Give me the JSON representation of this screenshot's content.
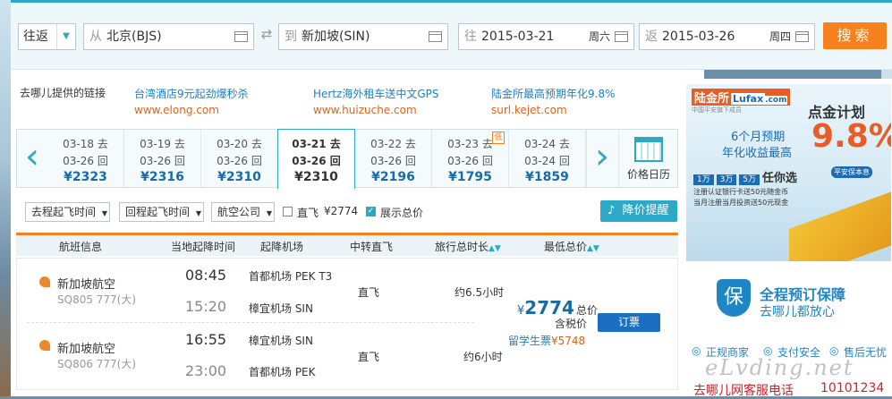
{
  "search": {
    "trip_type": "往返",
    "from_placeholder": "从",
    "from_value": "北京(BJS)",
    "to_placeholder": "到",
    "to_value": "新加坡(SIN)",
    "depart_placeholder": "往",
    "depart_date": "2015-03-21",
    "depart_weekday": "周六",
    "return_placeholder": "返",
    "return_date": "2015-03-26",
    "return_weekday": "周四",
    "search_button": "搜索"
  },
  "links": {
    "heading": "去哪儿提供的链接",
    "items": [
      {
        "title": "台湾酒店9元起劲爆秒杀",
        "url": "www.elong.com"
      },
      {
        "title": "Hertz海外租车送中文GPS",
        "url": "www.huizuche.com"
      },
      {
        "title": "陆金所最高预期年化9.8%",
        "url": "surl.kejet.com"
      }
    ]
  },
  "dates": [
    {
      "go": "03-18 去",
      "back": "03-26 回",
      "price": "¥2323"
    },
    {
      "go": "03-19 去",
      "back": "03-26 回",
      "price": "¥2316"
    },
    {
      "go": "03-20 去",
      "back": "03-26 回",
      "price": "¥2310"
    },
    {
      "go": "03-21 去",
      "back": "03-26 回",
      "price": "¥2310"
    },
    {
      "go": "03-22 去",
      "back": "03-26 回",
      "price": "¥2196"
    },
    {
      "go": "03-23 去",
      "back": "03-26 回",
      "price": "¥1795",
      "badge": "低"
    },
    {
      "go": "03-24 去",
      "back": "03-24 回",
      "price": "¥1859"
    }
  ],
  "price_calendar": "价格日历",
  "filters": {
    "outbound_time": "去程起飞时间",
    "return_time": "回程起飞时间",
    "airline": "航空公司",
    "direct_label": "直飞",
    "direct_price": "¥2774",
    "show_total": "展示总价",
    "price_alert": "降价提醒"
  },
  "table_headers": [
    "航班信息",
    "当地起降时间",
    "起降机场",
    "中转直飞",
    "旅行总时长",
    "最低总价"
  ],
  "flights": [
    {
      "airline": "新加坡航空",
      "flight_no": "SQ805 777(大)",
      "dep_time": "08:45",
      "dep_airport": "首都机场 PEK T3",
      "arr_time": "15:20",
      "arr_airport": "樟宜机场 SIN",
      "type": "直飞",
      "duration": "约6.5小时"
    },
    {
      "airline": "新加坡航空",
      "flight_no": "SQ806 777(大)",
      "dep_time": "16:55",
      "dep_airport": "樟宜机场 SIN",
      "arr_time": "23:00",
      "arr_airport": "首都机场 PEK",
      "type": "直飞",
      "duration": "约6小时"
    }
  ],
  "price_block": {
    "currency": "¥",
    "amount": "2774",
    "total_label": "总价",
    "tax_label": "含税价",
    "book_button": "订票",
    "student_label": "留学生票",
    "student_price": "¥5748"
  },
  "ad": {
    "brand": "陆金所",
    "brand_en": "Lufax",
    "brand_domain": ".com",
    "sub": "中国平安旗下成员",
    "headline": "点金计划",
    "line1": "6个月预期",
    "line2": "年化收益最高",
    "rate": "9.8%",
    "tags": [
      "1万",
      "3万",
      "5万"
    ],
    "tag_text": "任你选",
    "badge": "平安保本息",
    "bullet1": "注册认证银行卡送50元随金币",
    "bullet2": "当月注册当月投资送50元现金"
  },
  "guarantee": {
    "icon_char": "保",
    "title": "全程预订保障",
    "sub": "去哪儿都放心"
  },
  "trust": [
    "正规商家",
    "支付安全",
    "售后无忧"
  ],
  "hotline_label": "去哪儿网客服电话",
  "hotline": "10101234",
  "watermark": "eLvding.net",
  "colors": {
    "accent": "#2ba9c6",
    "orange": "#f7811e",
    "link": "#1b7fc6"
  }
}
